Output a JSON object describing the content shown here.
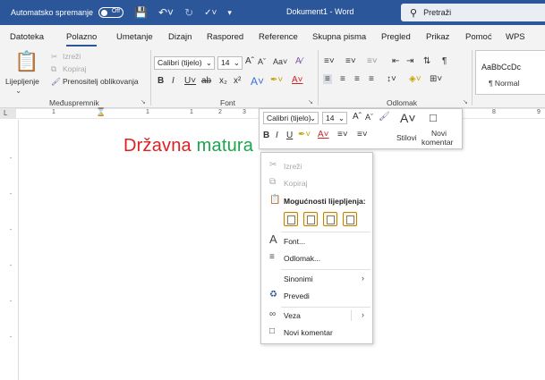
{
  "titlebar": {
    "autosave_label": "Automatsko spremanje",
    "autosave_state": "Off",
    "doc_title": "Dokument1 - Word",
    "search_placeholder": "Pretraži"
  },
  "tabs": [
    "Datoteka",
    "Polazno",
    "Umetanje",
    "Dizajn",
    "Raspored",
    "Reference",
    "Skupna pisma",
    "Pregled",
    "Prikaz",
    "Pomoć",
    "WPS"
  ],
  "active_tab": "Polazno",
  "ribbon": {
    "clipboard": {
      "paste_label": "Lijepljenje",
      "cut_label": "Izreži",
      "copy_label": "Kopiraj",
      "format_painter_label": "Prenositelj oblikovanja",
      "group_label": "Međuspremnik"
    },
    "font": {
      "font_name": "Calibri (tijelo)",
      "font_size": "14",
      "group_label": "Font"
    },
    "paragraph": {
      "group_label": "Odlomak"
    },
    "styles": {
      "preview": "AaBbCcDc",
      "normal_label": "¶ Normal"
    }
  },
  "ruler": {
    "numbers": [
      "1",
      "1",
      "1",
      "2",
      "3",
      "8",
      "9"
    ]
  },
  "document": {
    "word1": "Državna",
    "word2": "matura"
  },
  "mini_toolbar": {
    "font_name": "Calibri (tijelo)",
    "font_size": "14",
    "styles_label": "Stilovi",
    "comment_label_line1": "Novi",
    "comment_label_line2": "komentar"
  },
  "context_menu": {
    "cut": "Izreži",
    "copy": "Kopiraj",
    "paste_options": "Mogućnosti lijepljenja:",
    "font": "Font...",
    "paragraph": "Odlomak...",
    "synonyms": "Sinonimi",
    "translate": "Prevedi",
    "link": "Veza",
    "new_comment": "Novi komentar"
  },
  "colors": {
    "titlebar": "#2b579a",
    "red_word": "#e02020",
    "green_word": "#1aa54b"
  }
}
